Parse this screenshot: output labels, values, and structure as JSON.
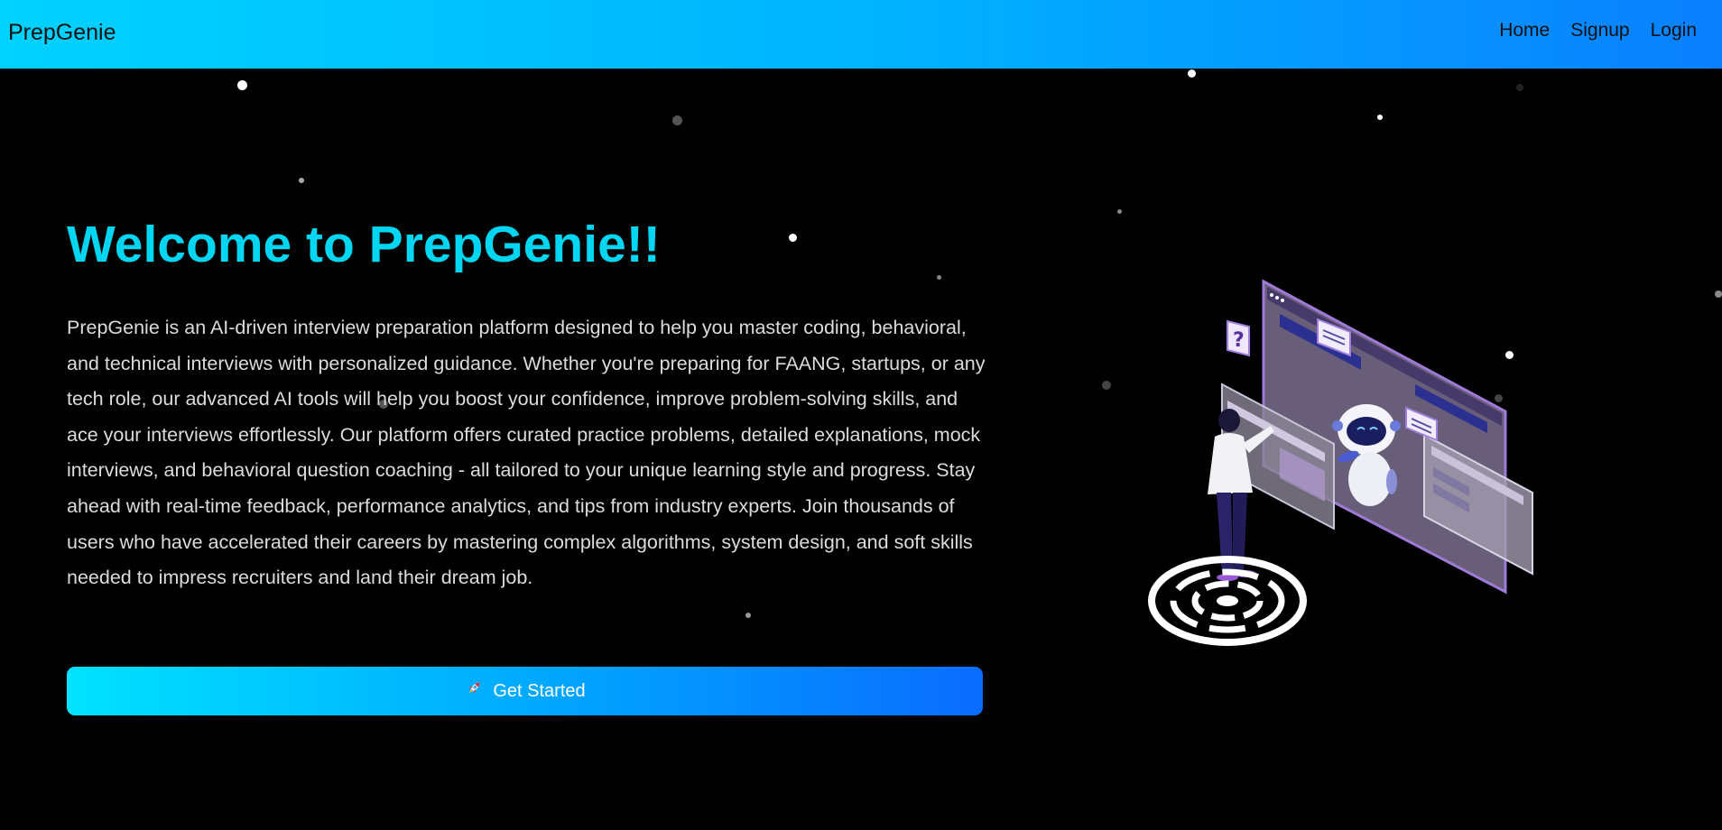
{
  "navbar": {
    "brand": "PrepGenie",
    "links": [
      {
        "label": "Home"
      },
      {
        "label": "Signup"
      },
      {
        "label": "Login"
      }
    ]
  },
  "hero": {
    "title": "Welcome to PrepGenie!!",
    "description": "PrepGenie is an AI-driven interview preparation platform designed to help you master coding, behavioral, and technical interviews with personalized guidance. Whether you're preparing for FAANG, startups, or any tech role, our advanced AI tools will help you boost your confidence, improve problem-solving skills, and ace your interviews effortlessly. Our platform offers curated practice problems, detailed explanations, mock interviews, and behavioral question coaching - all tailored to your unique learning style and progress. Stay ahead with real-time feedback, performance analytics, and tips from industry experts. Join thousands of users who have accelerated their careers by mastering complex algorithms, system design, and soft skills needed to impress recruiters and land their dream job.",
    "cta_label": "Get Started",
    "cta_icon": "rocket-icon"
  },
  "colors": {
    "nav_gradient_start": "#00d2ff",
    "nav_gradient_end": "#0a80ff",
    "title_color": "#00d6f2",
    "background": "#000000"
  }
}
